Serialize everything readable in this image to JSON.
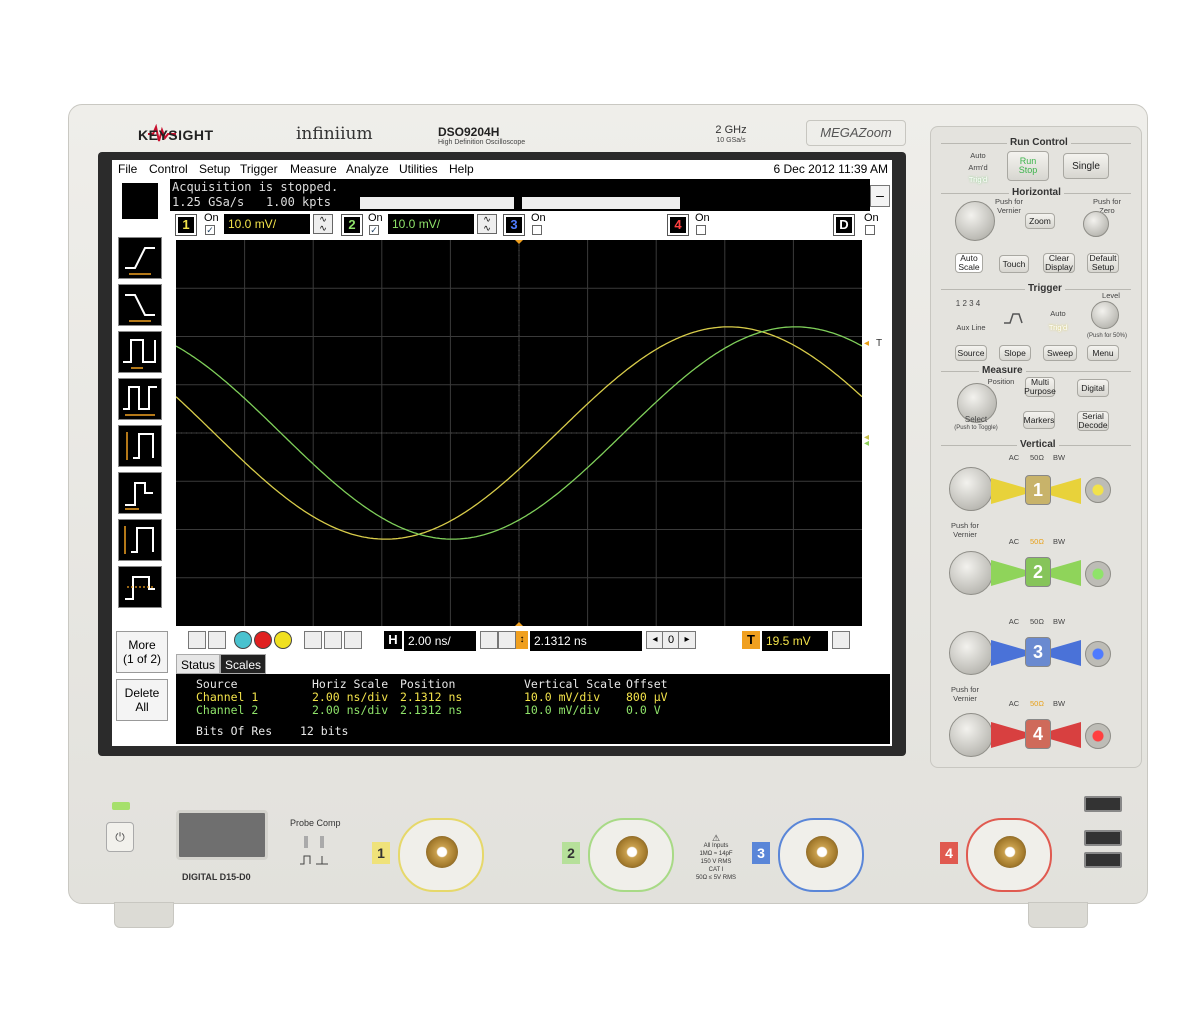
{
  "instrument": {
    "brand": "KEYSIGHT",
    "series": "infiniium",
    "model": "DSO9204H",
    "model_desc": "High Definition Oscilloscope",
    "bandwidth": "2 GHz",
    "sample_rate": "10 GSa/s",
    "megazoom": "MEGAZoom"
  },
  "menubar": {
    "items": [
      "File",
      "Control",
      "Setup",
      "Trigger",
      "Measure",
      "Analyze",
      "Utilities",
      "Help"
    ],
    "datetime": "6 Dec 2012 11:39 AM"
  },
  "acquisition": {
    "status": "Acquisition is stopped.",
    "rate": "1.25 GSa/s",
    "points": "1.00 kpts",
    "minimize": "–"
  },
  "channels": [
    {
      "num": "1",
      "on_label": "On",
      "checked": true,
      "scale": "10.0 mV/",
      "color": "#f2e24a"
    },
    {
      "num": "2",
      "on_label": "On",
      "checked": true,
      "scale": "10.0 mV/",
      "color": "#8fe36a"
    },
    {
      "num": "3",
      "on_label": "On",
      "checked": false,
      "color": "#4f7bff"
    },
    {
      "num": "4",
      "on_label": "On",
      "checked": false,
      "color": "#ff4040"
    },
    {
      "num": "D",
      "on_label": "On",
      "checked": false,
      "color": "#ffffff"
    }
  ],
  "side_buttons": {
    "more": "More",
    "more_page": "(1 of 2)",
    "delete": "Delete",
    "delete_all": "All"
  },
  "horizontal": {
    "label": "H",
    "scale": "2.00 ns/",
    "position": "2.1312 ns",
    "delay_ref": "0"
  },
  "trigger_level": {
    "label": "T",
    "value": "19.5 mV"
  },
  "tabs": [
    "Status",
    "Scales"
  ],
  "scales_table": {
    "headers": [
      "Source",
      "Horiz Scale",
      "Position",
      "Vertical Scale",
      "Offset"
    ],
    "rows": [
      [
        "Channel 1",
        "2.00 ns/div",
        "2.1312 ns",
        "10.0 mV/div",
        "800 µV"
      ],
      [
        "Channel 2",
        "2.00 ns/div",
        "2.1312 ns",
        "10.0 mV/div",
        "0.0 V"
      ]
    ],
    "bits_label": "Bits Of Res",
    "bits_value": "12 bits"
  },
  "waveforms": {
    "grid": {
      "divisions_x": 10,
      "divisions_y": 8
    },
    "series": [
      {
        "color": "#d8cc4a",
        "amplitude_div": 2.2,
        "phase_deg": 160
      },
      {
        "color": "#7fcf5a",
        "amplitude_div": 2.2,
        "phase_deg": 125
      }
    ],
    "marker_trigger": "T"
  },
  "panel": {
    "run_control": "Run Control",
    "auto": "Auto",
    "armd": "Arm'd",
    "trigd": "Trig'd",
    "run": "Run",
    "stop": "Stop",
    "single": "Single",
    "horizontal": "Horizontal",
    "push_vernier": "Push for Vernier",
    "push_zero": "Push for Zero",
    "zoom": "Zoom",
    "auto_scale": "Auto Scale",
    "touch": "Touch",
    "clear_display": "Clear Display",
    "default_setup": "Default Setup",
    "trigger": "Trigger",
    "level": "Level",
    "src_nums": "1 2 3 4",
    "aux_line": "Aux Line",
    "trig_auto": "Auto",
    "trig_trigd": "Trig'd",
    "push_50": "(Push for 50%)",
    "source": "Source",
    "slope": "Slope",
    "sweep": "Sweep",
    "menu": "Menu",
    "measure": "Measure",
    "position": "Position",
    "multi_purpose": "Multi Purpose",
    "digital": "Digital",
    "select": "Select",
    "push_toggle": "(Push to Toggle)",
    "markers": "Markers",
    "serial_decode": "Serial Decode",
    "vertical": "Vertical",
    "ac": "AC",
    "ohm": "50Ω",
    "bw": "BW",
    "push_vernier2": "Push for Vernier"
  },
  "front": {
    "digital_label": "DIGITAL D15-D0",
    "probe_comp": "Probe Comp",
    "warning": [
      "All Inputs",
      "1MΩ ≈ 14pF",
      "150 V RMS",
      "CAT I",
      "50Ω ≤ 5V RMS"
    ]
  }
}
